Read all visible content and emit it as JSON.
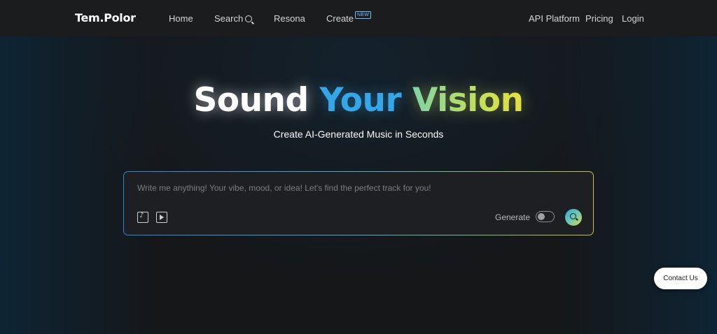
{
  "nav": {
    "logo": "Tem.Polor",
    "links": {
      "home": "Home",
      "search": "Search",
      "resona": "Resona",
      "create": "Create",
      "create_badge": "NEW",
      "api_platform": "API Platform",
      "pricing": "Pricing",
      "login": "Login"
    }
  },
  "hero": {
    "title_word1": "Sound",
    "title_word2": "Your",
    "title_word3": "Vision",
    "subtitle": "Create AI-Generated Music in Seconds"
  },
  "prompt": {
    "placeholder": "Write me anything! Your vibe, mood, or idea! Let's find the perfect track for you!",
    "value": "",
    "generate_label": "Generate",
    "generate_enabled": false,
    "icons": {
      "music_file": "music-file-icon",
      "video": "play-video-icon",
      "submit": "search-icon"
    }
  },
  "contact": {
    "label": "Contact Us"
  },
  "colors": {
    "accent_blue": "#35a6e8",
    "accent_yellow": "#e6e040",
    "nav_bg": "#1b1c1e",
    "page_bg": "#131416"
  }
}
